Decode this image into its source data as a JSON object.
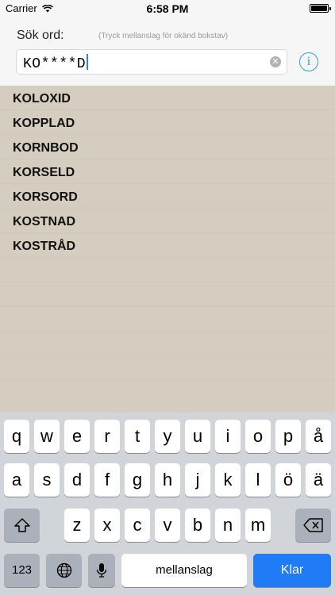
{
  "status_bar": {
    "carrier": "Carrier",
    "time": "6:58 PM"
  },
  "search": {
    "label": "Sök ord:",
    "hint": "(Tryck mellanslag för okänd bokstav)",
    "value": "KO****D",
    "clear_icon": "clear-circle-icon",
    "info_icon": "info-icon"
  },
  "results": [
    "KOLOXID",
    "KOPPLAD",
    "KORNBOD",
    "KORSELD",
    "KORSORD",
    "KOSTNAD",
    "KOSTRÅD"
  ],
  "keyboard": {
    "row1": [
      "q",
      "w",
      "e",
      "r",
      "t",
      "y",
      "u",
      "i",
      "o",
      "p",
      "å"
    ],
    "row2": [
      "a",
      "s",
      "d",
      "f",
      "g",
      "h",
      "j",
      "k",
      "l",
      "ö",
      "ä"
    ],
    "row3": [
      "z",
      "x",
      "c",
      "v",
      "b",
      "n",
      "m"
    ],
    "numbers_label": "123",
    "space_label": "mellanslag",
    "return_label": "Klar"
  },
  "colors": {
    "accent": "#2aa2d6",
    "return_key": "#1f7bf6",
    "results_bg": "#d5cdbf"
  }
}
